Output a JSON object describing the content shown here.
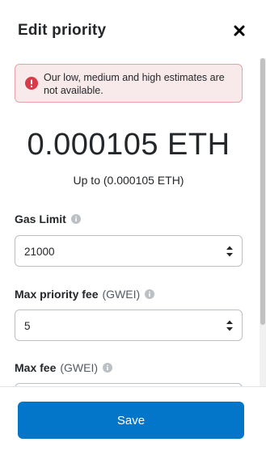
{
  "header": {
    "title": "Edit priority",
    "close_icon": "close-icon"
  },
  "alert": {
    "icon": "error-icon",
    "text": "Our low, medium and high estimates are not available."
  },
  "estimate": {
    "amount": "0.000105 ETH",
    "max_text": "Up to (0.000105 ETH)"
  },
  "fields": {
    "gas_limit": {
      "label": "Gas Limit",
      "unit": "",
      "value": "21000"
    },
    "max_priority_fee": {
      "label": "Max priority fee",
      "unit": "(GWEI)",
      "value": "5"
    },
    "max_fee": {
      "label": "Max fee",
      "unit": "(GWEI)",
      "value": ""
    }
  },
  "footer": {
    "save_label": "Save"
  },
  "colors": {
    "primary": "#0376c9",
    "error": "#d73a49",
    "error_bg": "#f8eaea"
  }
}
